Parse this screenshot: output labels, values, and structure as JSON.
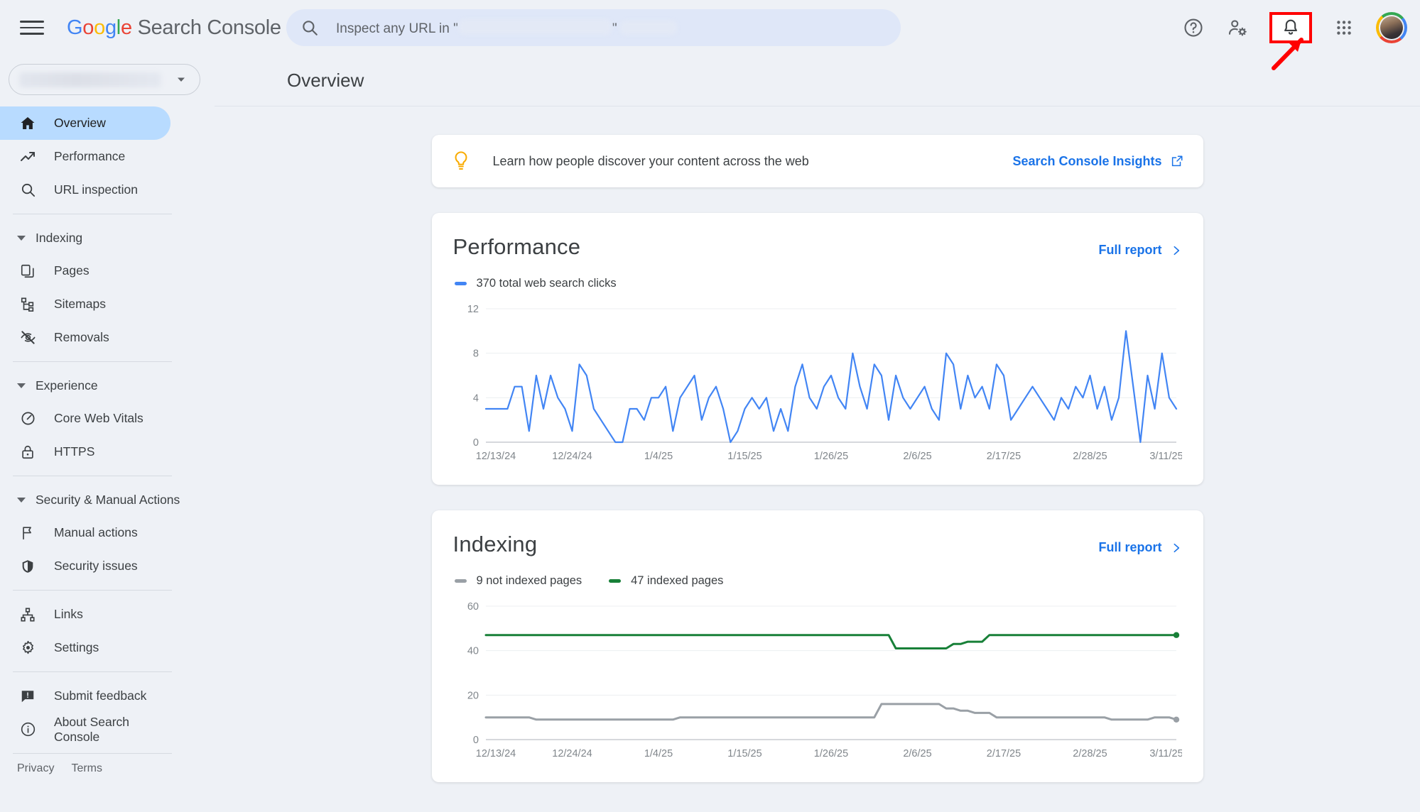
{
  "topbar": {
    "menu_icon": "hamburger-menu-icon",
    "brand": {
      "g": "G",
      "o1": "o",
      "o2": "o",
      "g2": "g",
      "l": "l",
      "e": "e",
      "product": "Search Console"
    },
    "search": {
      "icon": "search-icon",
      "placeholder_prefix": "Inspect any URL in \"",
      "placeholder_suffix": "\"",
      "value": ""
    },
    "icons": [
      {
        "name": "help-icon",
        "label": "Help"
      },
      {
        "name": "account-settings-icon",
        "label": "Account settings"
      },
      {
        "name": "notifications-bell-icon",
        "label": "Notifications",
        "highlighted": true
      },
      {
        "name": "google-apps-grid-icon",
        "label": "Google apps"
      },
      {
        "name": "avatar",
        "label": "Google Account"
      }
    ],
    "annotation": {
      "box_color": "#ff0000",
      "arrow_color": "#ff0000",
      "target": "notifications-bell-icon"
    }
  },
  "sidebar": {
    "property_selector": {
      "value": "",
      "redacted": true,
      "caret_icon": "chevron-down-icon"
    },
    "items": [
      {
        "label": "Overview",
        "icon": "home-icon",
        "active": true
      },
      {
        "label": "Performance",
        "icon": "trending-up-icon",
        "active": false
      },
      {
        "label": "URL inspection",
        "icon": "search-icon",
        "active": false
      }
    ],
    "groups": [
      {
        "label": "Indexing",
        "items": [
          {
            "label": "Pages",
            "icon": "pages-copy-icon"
          },
          {
            "label": "Sitemaps",
            "icon": "sitemap-tree-icon"
          },
          {
            "label": "Removals",
            "icon": "eye-off-icon"
          }
        ]
      },
      {
        "label": "Experience",
        "items": [
          {
            "label": "Core Web Vitals",
            "icon": "speedometer-icon"
          },
          {
            "label": "HTTPS",
            "icon": "lock-icon"
          }
        ]
      },
      {
        "label": "Security & Manual Actions",
        "items": [
          {
            "label": "Manual actions",
            "icon": "flag-icon"
          },
          {
            "label": "Security issues",
            "icon": "shield-icon"
          }
        ]
      }
    ],
    "standalone": [
      {
        "label": "Links",
        "icon": "links-hierarchy-icon"
      },
      {
        "label": "Settings",
        "icon": "gear-icon"
      }
    ],
    "utility": [
      {
        "label": "Submit feedback",
        "icon": "feedback-icon"
      },
      {
        "label": "About Search Console",
        "icon": "info-icon"
      }
    ],
    "footer": [
      {
        "label": "Privacy"
      },
      {
        "label": "Terms"
      }
    ]
  },
  "page": {
    "title": "Overview"
  },
  "banner": {
    "icon": "lightbulb-icon",
    "text": "Learn how people discover your content across the web",
    "link": "Search Console Insights",
    "link_icon": "open-in-new-icon"
  },
  "cards": [
    {
      "title": "Performance",
      "action": "Full report",
      "action_icon": "chevron-right-icon",
      "legend": [
        {
          "label": "370 total web search clicks",
          "color": "#4285F4"
        }
      ]
    },
    {
      "title": "Indexing",
      "action": "Full report",
      "action_icon": "chevron-right-icon",
      "legend": [
        {
          "label": "9 not indexed pages",
          "color": "#9aa0a6"
        },
        {
          "label": "47 indexed pages",
          "color": "#188038"
        }
      ]
    }
  ],
  "chart_data": [
    {
      "type": "line",
      "title": "Performance",
      "xlabel": "",
      "ylabel": "",
      "ylim": [
        0,
        12
      ],
      "yticks": [
        0,
        4,
        8,
        12
      ],
      "grid": true,
      "legend_position": "top-left",
      "x_tick_labels": [
        "12/13/24",
        "12/24/24",
        "1/4/25",
        "1/15/25",
        "1/26/25",
        "2/6/25",
        "2/17/25",
        "2/28/25",
        "3/11/25"
      ],
      "series": [
        {
          "name": "370 total web search clicks",
          "color": "#4285F4",
          "values": [
            3,
            3,
            3,
            3,
            5,
            5,
            1,
            6,
            3,
            6,
            4,
            3,
            1,
            7,
            6,
            3,
            2,
            1,
            0,
            0,
            3,
            3,
            2,
            4,
            4,
            5,
            1,
            4,
            5,
            6,
            2,
            4,
            5,
            3,
            0,
            1,
            3,
            4,
            3,
            4,
            1,
            3,
            1,
            5,
            7,
            4,
            3,
            5,
            6,
            4,
            3,
            8,
            5,
            3,
            7,
            6,
            2,
            6,
            4,
            3,
            4,
            5,
            3,
            2,
            8,
            7,
            3,
            6,
            4,
            5,
            3,
            7,
            6,
            2,
            3,
            4,
            5,
            4,
            3,
            2,
            4,
            3,
            5,
            4,
            6,
            3,
            5,
            2,
            4,
            10,
            5,
            0,
            6,
            3,
            8,
            4,
            3
          ]
        }
      ]
    },
    {
      "type": "line",
      "title": "Indexing",
      "xlabel": "",
      "ylabel": "",
      "ylim": [
        0,
        60
      ],
      "yticks": [
        0,
        20,
        40,
        60
      ],
      "grid": true,
      "legend_position": "top-left",
      "x_tick_labels": [
        "12/13/24",
        "12/24/24",
        "1/4/25",
        "1/15/25",
        "1/26/25",
        "2/6/25",
        "2/17/25",
        "2/28/25",
        "3/11/25"
      ],
      "series": [
        {
          "name": "47 indexed pages",
          "color": "#188038",
          "values": [
            47,
            47,
            47,
            47,
            47,
            47,
            47,
            47,
            47,
            47,
            47,
            47,
            47,
            47,
            47,
            47,
            47,
            47,
            47,
            47,
            47,
            47,
            47,
            47,
            47,
            47,
            47,
            47,
            47,
            47,
            47,
            47,
            47,
            47,
            47,
            47,
            47,
            47,
            47,
            47,
            47,
            47,
            47,
            47,
            47,
            47,
            47,
            47,
            47,
            47,
            47,
            47,
            47,
            47,
            47,
            47,
            47,
            41,
            41,
            41,
            41,
            41,
            41,
            41,
            41,
            43,
            43,
            44,
            44,
            44,
            47,
            47,
            47,
            47,
            47,
            47,
            47,
            47,
            47,
            47,
            47,
            47,
            47,
            47,
            47,
            47,
            47,
            47,
            47,
            47,
            47,
            47,
            47,
            47,
            47,
            47,
            47
          ]
        },
        {
          "name": "9 not indexed pages",
          "color": "#9aa0a6",
          "values": [
            10,
            10,
            10,
            10,
            10,
            10,
            10,
            9,
            9,
            9,
            9,
            9,
            9,
            9,
            9,
            9,
            9,
            9,
            9,
            9,
            9,
            9,
            9,
            9,
            9,
            9,
            9,
            10,
            10,
            10,
            10,
            10,
            10,
            10,
            10,
            10,
            10,
            10,
            10,
            10,
            10,
            10,
            10,
            10,
            10,
            10,
            10,
            10,
            10,
            10,
            10,
            10,
            10,
            10,
            10,
            16,
            16,
            16,
            16,
            16,
            16,
            16,
            16,
            16,
            14,
            14,
            13,
            13,
            12,
            12,
            12,
            10,
            10,
            10,
            10,
            10,
            10,
            10,
            10,
            10,
            10,
            10,
            10,
            10,
            10,
            10,
            10,
            9,
            9,
            9,
            9,
            9,
            9,
            10,
            10,
            10,
            9
          ]
        }
      ]
    }
  ]
}
